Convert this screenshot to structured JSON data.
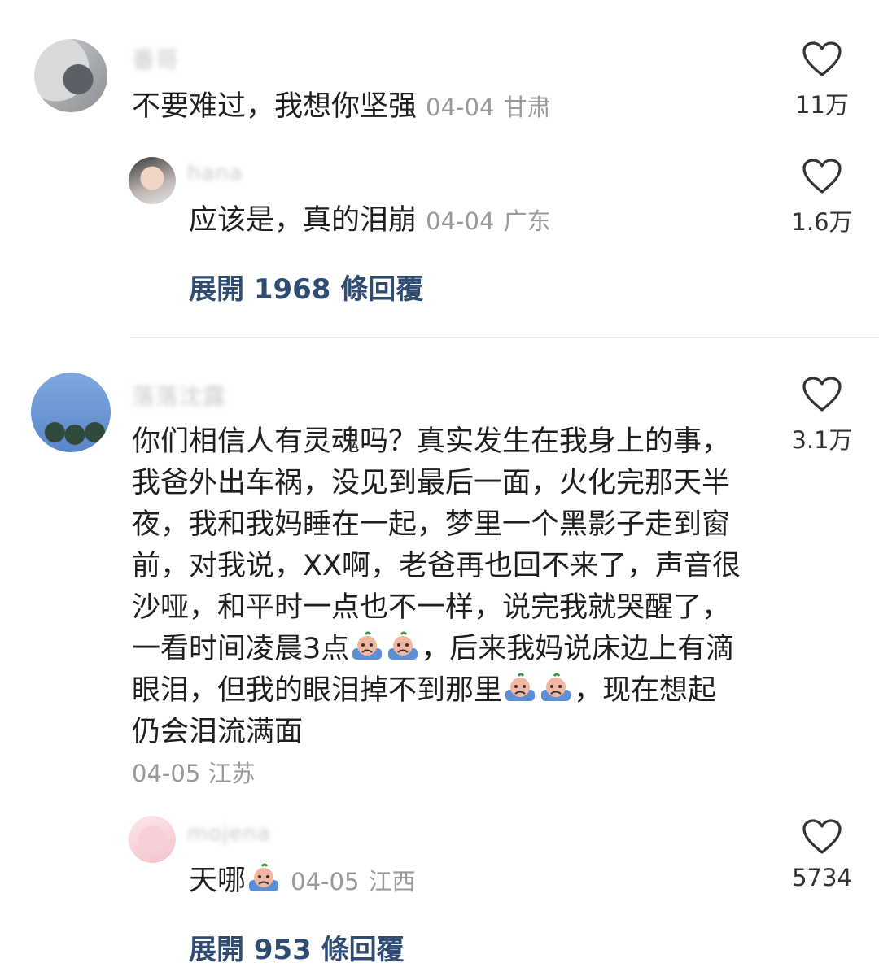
{
  "comments": [
    {
      "username": "番哥",
      "text": "不要难过，我想你坚强",
      "date": "04-04",
      "location": "甘肃",
      "likes": "11万",
      "reply": {
        "username": "hana",
        "text": "应该是，真的泪崩",
        "date": "04-04",
        "location": "广东",
        "likes": "1.6万"
      },
      "expand_label": "展開 1968 條回覆"
    },
    {
      "username": "落落沈露",
      "text_parts": [
        "你们相信人有灵魂吗？真实发生在我身上的事，我爸外出车祸，没见到最后一面，火化完那天半夜，我和我妈睡在一起，梦里一个黑影子走到窗前，对我说，XX啊，老爸再也回不来了，声音很沙哑，和平时一点也不一样，说完我就哭醒了，一看时间凌晨3点",
        "，后来我妈说床边上有滴眼泪，但我的眼泪掉不到那里",
        "，现在想起仍会泪流满面"
      ],
      "date": "04-05",
      "location": "江苏",
      "likes": "3.1万",
      "reply": {
        "username": "mojena",
        "text": "天哪",
        "date": "04-05",
        "location": "江西",
        "likes": "5734"
      },
      "expand_label": "展開 953 條回覆"
    }
  ],
  "icons": {
    "like": "heart-outline-icon",
    "emoji": "crying-emoji-icon"
  },
  "colors": {
    "expand_link": "#2f4c73",
    "meta": "#9a9a9a"
  }
}
